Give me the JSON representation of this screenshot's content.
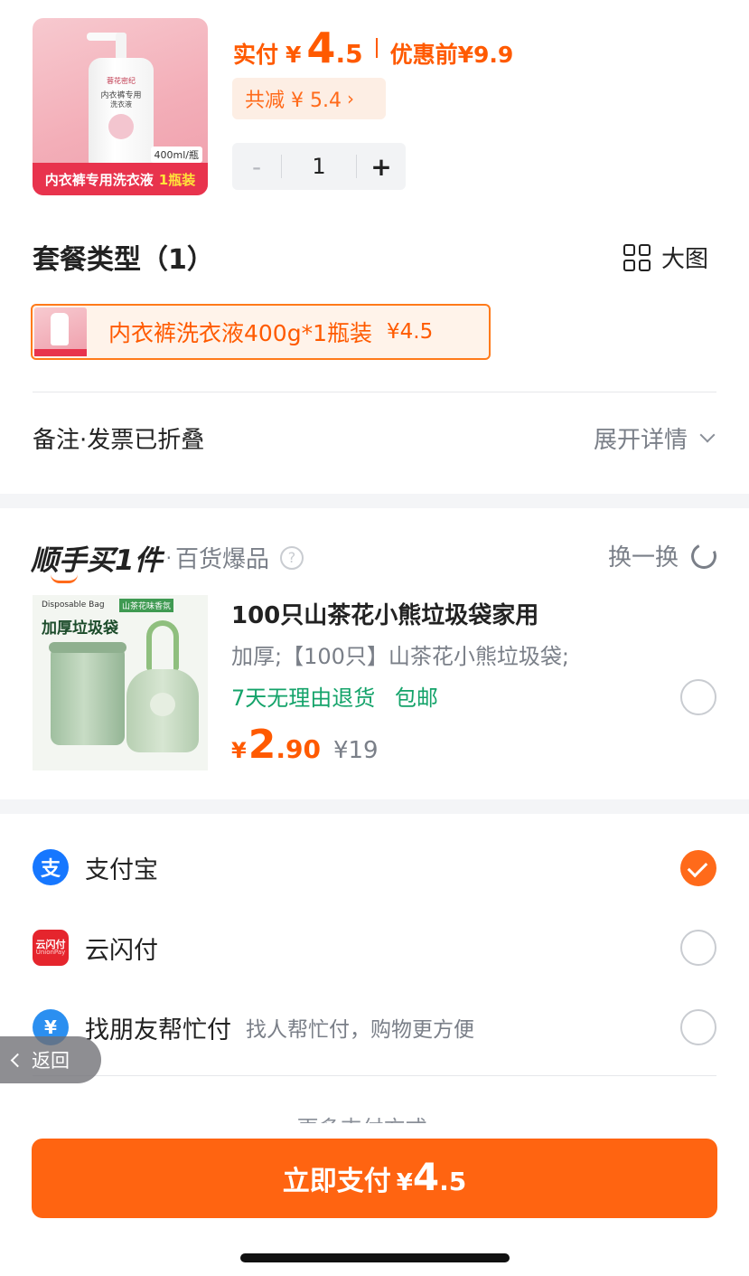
{
  "product": {
    "image_brand": "蓉花密纪",
    "image_name_line1": "内衣裤专用",
    "image_name_line2": "洗衣液",
    "image_volume": "400ml/瓶",
    "image_banner_text": "内衣裤专用洗衣液",
    "image_banner_highlight": "1瓶装",
    "paid_label": "实付",
    "currency": "¥",
    "paid_int": "4",
    "paid_dec": ".5",
    "before_discount": "优惠前¥9.9",
    "total_reduce": "共减 ¥ 5.4",
    "quantity": "1",
    "minus": "-",
    "plus": "+"
  },
  "package": {
    "title": "套餐类型（1）",
    "big_view": "大图",
    "option_label": "内衣裤洗衣液400g*1瓶装",
    "option_price": "¥4.5"
  },
  "note": {
    "label": "备注·发票已折叠",
    "expand": "展开详情"
  },
  "extra": {
    "brand": "顺手买1件",
    "dot": "·",
    "subtitle": "百货爆品",
    "swap": "换一换",
    "item": {
      "image_small_label": "Disposable Bag",
      "image_tag": "山茶花味香氛",
      "image_heading": "加厚垃圾袋",
      "title": "100只山茶花小熊垃圾袋家用",
      "desc": "加厚;【100只】山茶花小熊垃圾袋;",
      "tag1": "7天无理由退货",
      "tag2": "包邮",
      "currency": "¥",
      "price_int": "2",
      "price_dec": ".90",
      "orig_price": "¥19",
      "selected": false
    }
  },
  "payment": {
    "methods": [
      {
        "name": "支付宝",
        "desc": "",
        "icon": "alipay-icon",
        "icon_text": "支",
        "selected": true
      },
      {
        "name": "云闪付",
        "desc": "",
        "icon": "unionpay-icon",
        "icon_text": "云闪付",
        "icon_sub": "UnionPay",
        "selected": false
      },
      {
        "name": "找朋友帮忙付",
        "desc": "找人帮忙付，购物更方便",
        "icon": "friend-pay-icon",
        "icon_text": "¥",
        "selected": false
      }
    ],
    "more": "更多支付方式 ⌄"
  },
  "back": "返回",
  "pay_button": {
    "label": "立即支付",
    "currency": "¥",
    "amount_int": "4",
    "amount_dec": ".5"
  },
  "colors": {
    "accent": "#ff6411",
    "price": "#ff5a00",
    "green_tag": "#14a36a",
    "alipay": "#1677ff",
    "unionpay": "#e5252d"
  }
}
